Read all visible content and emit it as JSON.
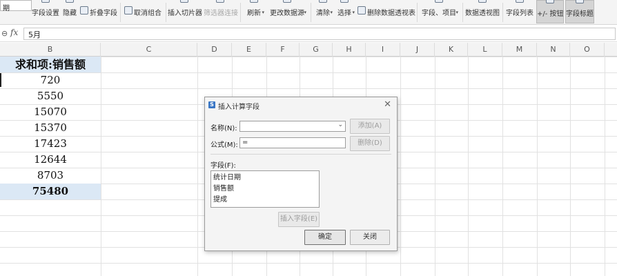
{
  "ribbon": {
    "left_field": "期",
    "groups": [
      {
        "label": "字段设置",
        "state": "normal"
      },
      {
        "label": "隐藏",
        "state": "normal"
      },
      {
        "label": "折叠字段",
        "state": "normal"
      },
      {
        "label": "取消组合",
        "state": "normal"
      },
      {
        "label": "插入切片器",
        "state": "normal"
      },
      {
        "label": "筛选器连接",
        "state": "disabled"
      },
      {
        "label": "刷新",
        "state": "normal"
      },
      {
        "label": "更改数据源",
        "state": "normal"
      },
      {
        "label": "清除",
        "state": "normal"
      },
      {
        "label": "选择",
        "state": "normal"
      },
      {
        "label": "删除数据透视表",
        "state": "normal"
      },
      {
        "label": "字段、项目",
        "state": "normal"
      },
      {
        "label": "数据透视图",
        "state": "normal"
      },
      {
        "label": "字段列表",
        "state": "normal"
      },
      {
        "label": "+/- 按钮",
        "state": "pressed"
      },
      {
        "label": "字段标题",
        "state": "pressed"
      }
    ]
  },
  "formula_bar": {
    "zoom_icon": "zoom-icon",
    "fx": "fx",
    "value": "5月"
  },
  "columns": [
    "B",
    "C",
    "D",
    "E",
    "F",
    "G",
    "H",
    "I",
    "J",
    "K",
    "L",
    "M",
    "N",
    "O"
  ],
  "pivot": {
    "header": "求和项:销售额",
    "values": [
      "720",
      "5550",
      "15070",
      "15370",
      "17423",
      "12644",
      "8703"
    ],
    "total": "75480"
  },
  "dialog": {
    "icon": "S",
    "title": "插入计算字段",
    "name_label": "名称(N):",
    "name_value": "",
    "formula_label": "公式(M):",
    "formula_value": "=",
    "add_button": "添加(A)",
    "delete_button": "删除(D)",
    "fields_label": "字段(F):",
    "fields": [
      "统计日期",
      "销售额",
      "提成"
    ],
    "insert_field_button": "插入字段(E)",
    "ok_button": "确定",
    "close_button": "关闭"
  }
}
